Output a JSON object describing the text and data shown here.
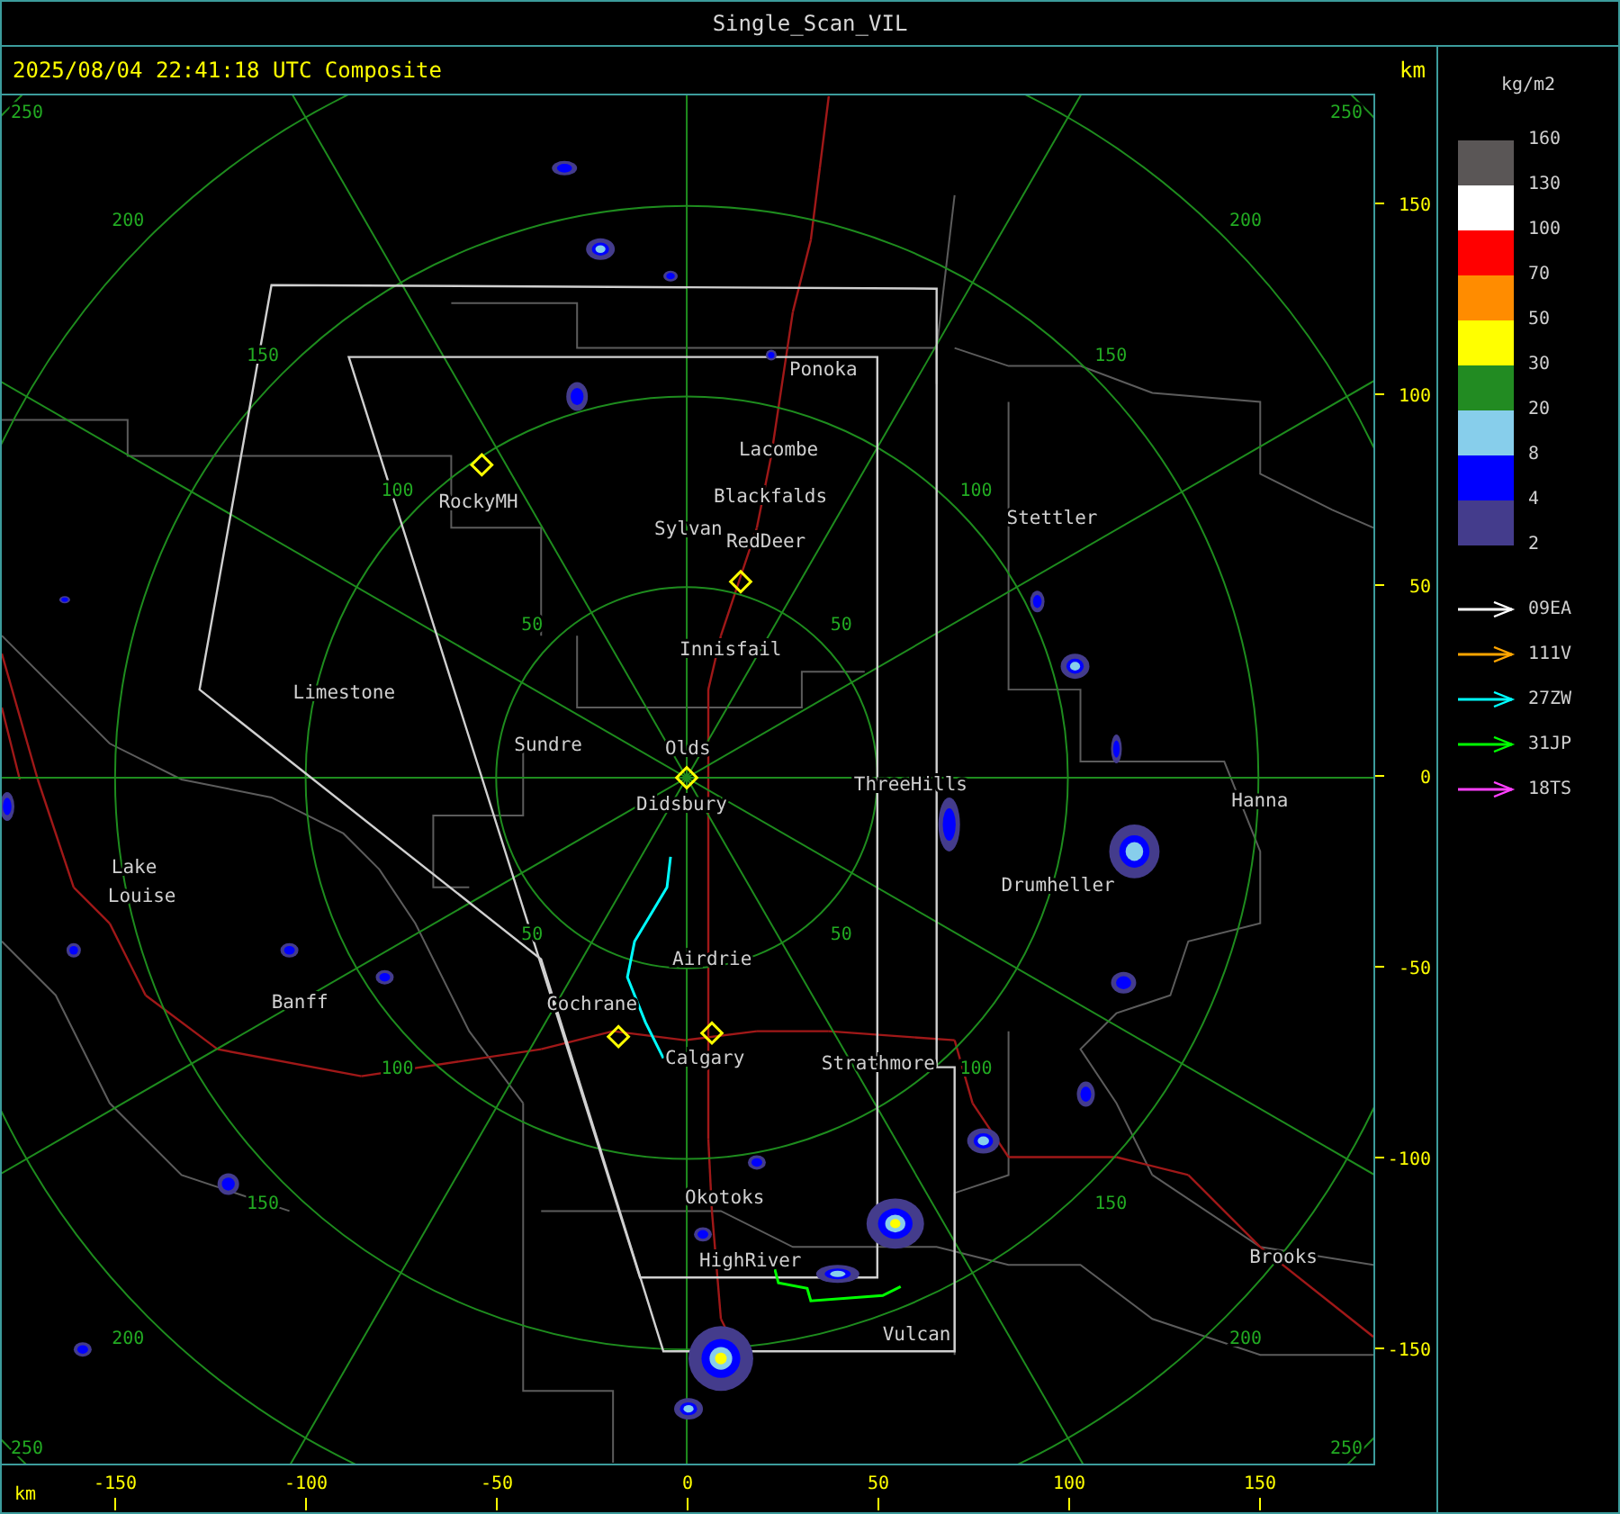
{
  "title": "Single_Scan_VIL",
  "timestamp": "2025/08/04 22:41:18 UTC Composite",
  "map": {
    "unit": "km",
    "range_rings": [
      {
        "labels": [
          "50",
          "50",
          "50",
          "50"
        ]
      },
      {
        "labels": [
          "100",
          "100",
          "100",
          "100"
        ]
      },
      {
        "labels": [
          "150",
          "150",
          "150",
          "150"
        ]
      },
      {
        "labels": [
          "200",
          "200",
          "200",
          "200"
        ]
      },
      {
        "labels": [
          "250",
          "250",
          "250",
          "250"
        ]
      }
    ],
    "towns": [
      "Ponoka",
      "Lacombe",
      "Blackfalds",
      "RockyMH",
      "Sylvan",
      "RedDeer",
      "Stettler",
      "Innisfail",
      "Limestone",
      "Sundre",
      "Olds",
      "Didsbury",
      "ThreeHills",
      "Hanna",
      "Lake",
      "Louise",
      "Drumheller",
      "Banff",
      "Airdrie",
      "Cochrane",
      "Calgary",
      "Strathmore",
      "Okotoks",
      "HighRiver",
      "Brooks",
      "Vulcan"
    ],
    "x_axis": {
      "unit": "km",
      "ticks": [
        "-150",
        "-100",
        "-50",
        "0",
        "50",
        "100",
        "150"
      ]
    },
    "y_axis": {
      "ticks": [
        "150",
        "100",
        "50",
        "0",
        "-50",
        "-100",
        "-150"
      ]
    }
  },
  "legend": {
    "unit": "kg/m2",
    "bands": [
      {
        "color": "#5a5656"
      },
      {
        "color": "#ffffff"
      },
      {
        "color": "#ff0000"
      },
      {
        "color": "#ff8c00"
      },
      {
        "color": "#ffff00"
      },
      {
        "color": "#228b22"
      },
      {
        "color": "#87ceeb"
      },
      {
        "color": "#0000ff"
      },
      {
        "color": "#443c8c"
      }
    ],
    "levels": [
      "160",
      "130",
      "100",
      "70",
      "50",
      "30",
      "20",
      "8",
      "4",
      "2"
    ],
    "tracks": [
      {
        "name": "09EA",
        "color": "#ffffff"
      },
      {
        "name": "111V",
        "color": "#ffa500"
      },
      {
        "name": "27ZW",
        "color": "#00ffff"
      },
      {
        "name": "31JP",
        "color": "#00ff00"
      },
      {
        "name": "18TS",
        "color": "#ff40ff"
      }
    ]
  }
}
